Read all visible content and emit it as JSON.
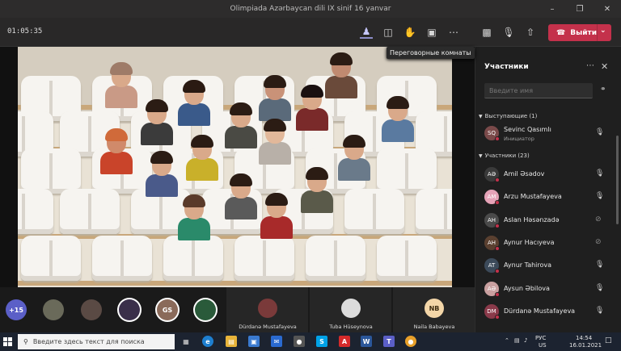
{
  "window": {
    "title": "Olimpiada Azərbaycan dili IX sinif 16 yanvar"
  },
  "toolbar": {
    "timer": "01:05:35",
    "leave_label": "Выйти",
    "tooltip": "Переговорные комнаты",
    "icons": [
      "participants-icon",
      "chat-icon",
      "raise-hand-icon",
      "breakout-rooms-icon",
      "more-icon",
      "camera-off-icon",
      "mic-icon",
      "share-icon"
    ]
  },
  "panel": {
    "title": "Участники",
    "search_placeholder": "Введите имя",
    "presenters_group": "Выступающие (1)",
    "attendees_group": "Участники (23)",
    "presenter": {
      "name": "Sevinc Qasımlı",
      "role": "Инициатор",
      "initials": "SQ"
    },
    "attendees": [
      {
        "name": "Amil Əsədov",
        "initials": "AƏ",
        "mic": "on",
        "color": "#3a3a3a"
      },
      {
        "name": "Arzu Mustafayeva",
        "initials": "AM",
        "mic": "on",
        "color": "#e6a3b8"
      },
      {
        "name": "Aslan Həsənzadə",
        "initials": "AH",
        "mic": "off",
        "color": "#4a4a4a"
      },
      {
        "name": "Aynur Hacıyeva",
        "initials": "AH",
        "mic": "off",
        "color": "#5a4030"
      },
      {
        "name": "Aynur Tahirova",
        "initials": "AT",
        "mic": "on",
        "color": "#3c4a5a"
      },
      {
        "name": "Aysun Əbilova",
        "initials": "AƏ",
        "mic": "on",
        "color": "#c9a0a0"
      },
      {
        "name": "Dürdanə Mustafayeva",
        "initials": "DM",
        "mic": "on",
        "color": "#8a3a4a"
      }
    ]
  },
  "strip": {
    "overflow": "+15",
    "bubbles": [
      {
        "initials": "",
        "color": "#6a6a5a",
        "ring": false
      },
      {
        "initials": "",
        "color": "#5a4a44",
        "ring": false
      },
      {
        "initials": "",
        "color": "#3a2f4a",
        "ring": true
      },
      {
        "initials": "GS",
        "color": "#8a6a5a",
        "ring": true
      },
      {
        "initials": "",
        "color": "#2a5a3a",
        "ring": true
      }
    ],
    "tiles": [
      {
        "name": "Dürdanə Mustafayeva",
        "initials": "",
        "color": "#7a3a3a"
      },
      {
        "name": "Tuba Hüseynova",
        "initials": "",
        "color": "#dcdcdc"
      },
      {
        "name": "Naila Babayeva",
        "initials": "NB",
        "color": "#f3d6a8"
      }
    ]
  },
  "taskbar": {
    "search_placeholder": "Введите здесь текст для поиска",
    "lang_top": "РУС",
    "lang_bottom": "US",
    "time": "14:54",
    "date": "16.01.2021"
  }
}
